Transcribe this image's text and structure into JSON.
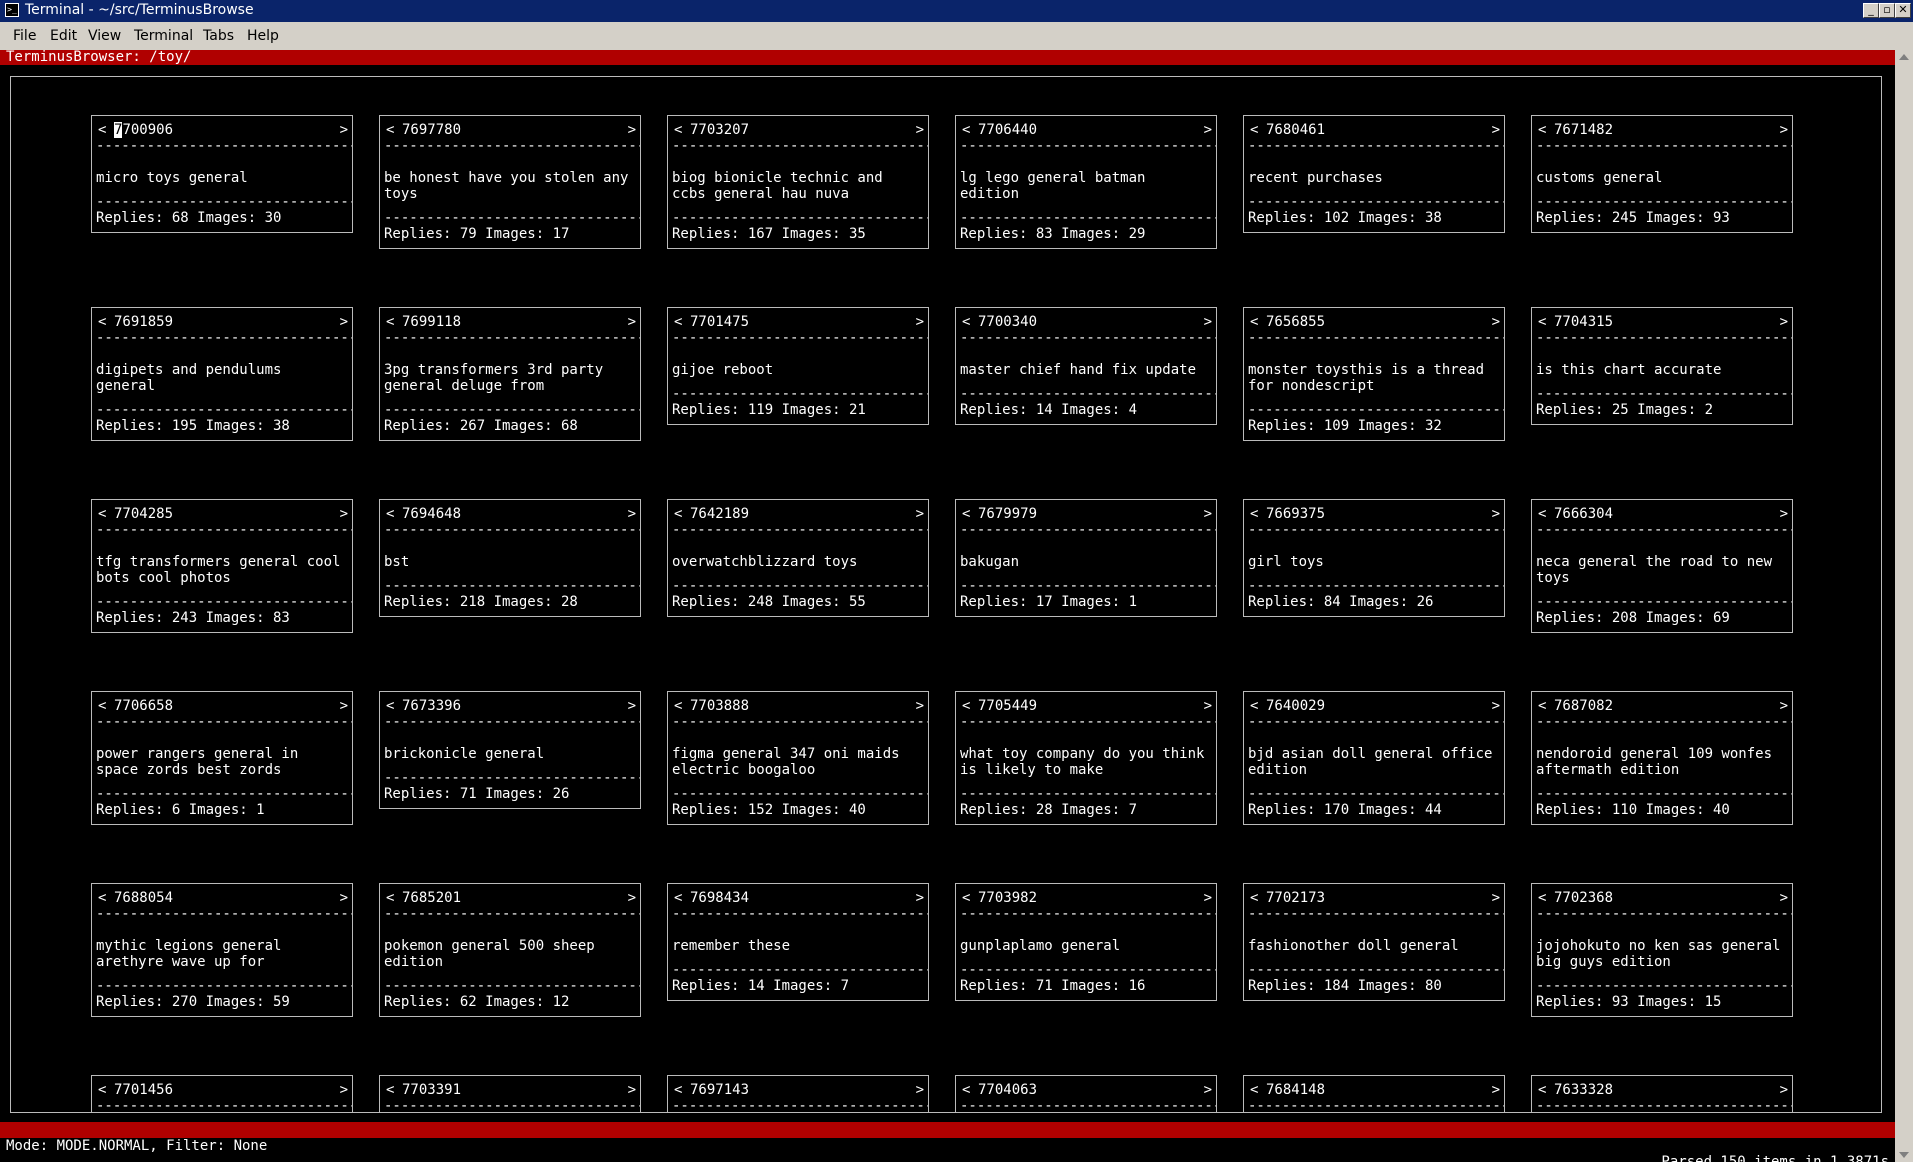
{
  "window": {
    "title": "Terminal - ~/src/TerminusBrowse",
    "icon": "terminal-app-icon",
    "controls": [
      "minimize",
      "maximize",
      "close"
    ]
  },
  "menu": [
    "File",
    "Edit",
    "View",
    "Terminal",
    "Tabs",
    "Help"
  ],
  "header": "TerminusBrowser: /toy/",
  "status": {
    "left": "Mode: MODE.NORMAL, Filter: None",
    "right": "Parsed 150 items in 1.3871s"
  },
  "separator": "-------------------------------------",
  "threads": [
    {
      "id": "7700906",
      "subject": "micro toys general",
      "stats": "Replies: 68 Images: 30"
    },
    {
      "id": "7697780",
      "subject": "be honest have you stolen any toys",
      "stats": "Replies: 79 Images: 17"
    },
    {
      "id": "7703207",
      "subject": "biog bionicle technic and ccbs general hau nuva",
      "stats": "Replies: 167 Images: 35"
    },
    {
      "id": "7706440",
      "subject": "lg lego general batman edition",
      "stats": "Replies: 83 Images: 29"
    },
    {
      "id": "7680461",
      "subject": "recent purchases",
      "stats": "Replies: 102 Images: 38"
    },
    {
      "id": "7671482",
      "subject": "customs general",
      "stats": "Replies: 245 Images: 93"
    },
    {
      "id": "7691859",
      "subject": "digipets and pendulums general",
      "stats": "Replies: 195 Images: 38"
    },
    {
      "id": "7699118",
      "subject": "3pg transformers 3rd party general deluge from",
      "stats": "Replies: 267 Images: 68"
    },
    {
      "id": "7701475",
      "subject": "gijoe reboot",
      "stats": "Replies: 119 Images: 21"
    },
    {
      "id": "7700340",
      "subject": "master chief hand fix update",
      "stats": "Replies: 14 Images: 4"
    },
    {
      "id": "7656855",
      "subject": "monster toysthis is a thread for nondescript",
      "stats": "Replies: 109 Images: 32"
    },
    {
      "id": "7704315",
      "subject": "is this chart accurate",
      "stats": "Replies: 25 Images: 2"
    },
    {
      "id": "7704285",
      "subject": "tfg transformers general cool bots cool photos",
      "stats": "Replies: 243 Images: 83"
    },
    {
      "id": "7694648",
      "subject": "bst",
      "stats": "Replies: 218 Images: 28"
    },
    {
      "id": "7642189",
      "subject": "overwatchblizzard toys",
      "stats": "Replies: 248 Images: 55"
    },
    {
      "id": "7679979",
      "subject": "bakugan",
      "stats": "Replies: 17 Images: 1"
    },
    {
      "id": "7669375",
      "subject": "girl toys",
      "stats": "Replies: 84 Images: 26"
    },
    {
      "id": "7666304",
      "subject": "neca general the road to new toys",
      "stats": "Replies: 208 Images: 69"
    },
    {
      "id": "7706658",
      "subject": "power rangers general in space zords best zords",
      "stats": "Replies: 6 Images: 1"
    },
    {
      "id": "7673396",
      "subject": "brickonicle general",
      "stats": "Replies: 71 Images: 26"
    },
    {
      "id": "7703888",
      "subject": "figma general 347 oni maids electric boogaloo",
      "stats": "Replies: 152 Images: 40"
    },
    {
      "id": "7705449",
      "subject": "what toy company do you think is likely to make",
      "stats": "Replies: 28 Images: 7"
    },
    {
      "id": "7640029",
      "subject": "bjd asian doll general office edition",
      "stats": "Replies: 170 Images: 44"
    },
    {
      "id": "7687082",
      "subject": "nendoroid general 109 wonfes aftermath edition",
      "stats": "Replies: 110 Images: 40"
    },
    {
      "id": "7688054",
      "subject": "mythic legions general arethyre wave up for",
      "stats": "Replies: 270 Images: 59"
    },
    {
      "id": "7685201",
      "subject": "pokemon general 500 sheep edition",
      "stats": "Replies: 62 Images: 12"
    },
    {
      "id": "7698434",
      "subject": "remember these",
      "stats": "Replies: 14 Images: 7"
    },
    {
      "id": "7703982",
      "subject": "gunplaplamo general",
      "stats": "Replies: 71 Images: 16"
    },
    {
      "id": "7702173",
      "subject": "fashionother doll general",
      "stats": "Replies: 184 Images: 80"
    },
    {
      "id": "7702368",
      "subject": "jojohokuto no ken sas general big guys edition",
      "stats": "Replies: 93 Images: 15"
    },
    {
      "id": "7701456",
      "subject": "",
      "stats": ""
    },
    {
      "id": "7703391",
      "subject": "",
      "stats": ""
    },
    {
      "id": "7697143",
      "subject": "",
      "stats": ""
    },
    {
      "id": "7704063",
      "subject": "",
      "stats": ""
    },
    {
      "id": "7684148",
      "subject": "",
      "stats": ""
    },
    {
      "id": "7633328",
      "subject": "",
      "stats": ""
    }
  ]
}
